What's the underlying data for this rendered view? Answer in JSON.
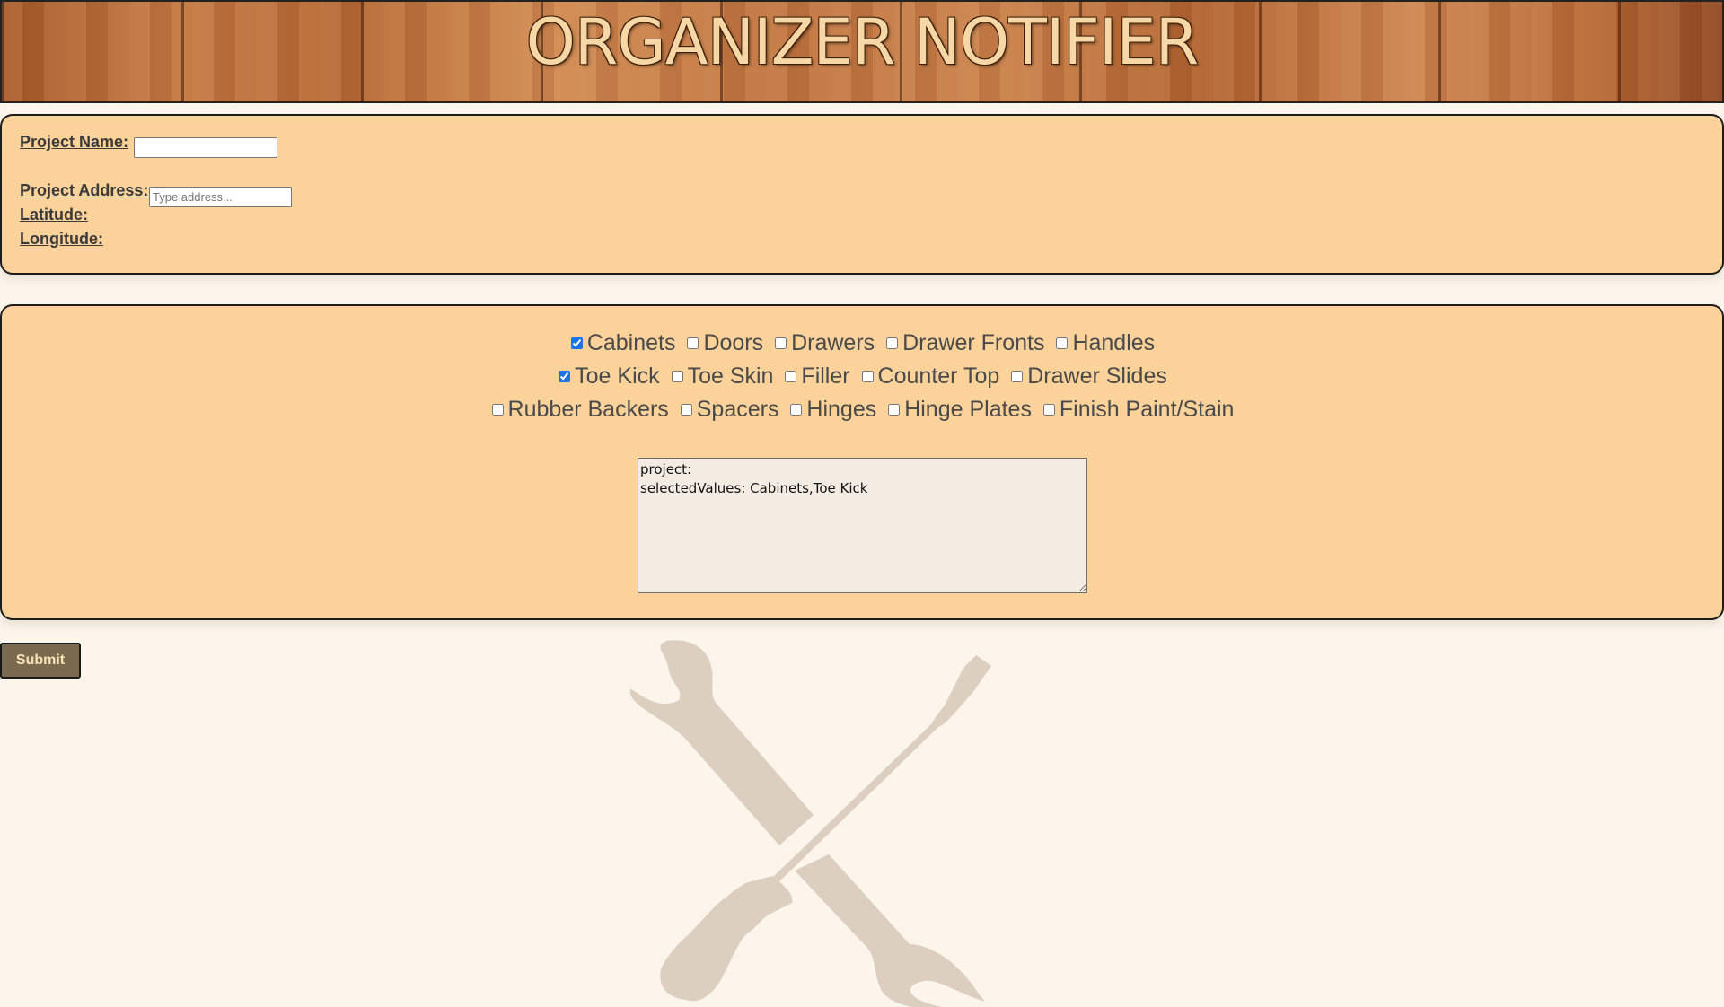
{
  "header": {
    "title": "ORGANIZER NOTIFIER"
  },
  "project": {
    "name_label": "Project Name:",
    "name_value": "",
    "address_label": "Project Address:",
    "address_placeholder": "Type address...",
    "address_value": "",
    "latitude_label": "Latitude:",
    "longitude_label": "Longitude:"
  },
  "items": {
    "rows": [
      [
        {
          "label": "Cabinets",
          "checked": true
        },
        {
          "label": "Doors",
          "checked": false
        },
        {
          "label": "Drawers",
          "checked": false
        },
        {
          "label": "Drawer Fronts",
          "checked": false
        },
        {
          "label": "Handles",
          "checked": false
        }
      ],
      [
        {
          "label": "Toe Kick",
          "checked": true
        },
        {
          "label": "Toe Skin",
          "checked": false
        },
        {
          "label": "Filler",
          "checked": false
        },
        {
          "label": "Counter Top",
          "checked": false
        },
        {
          "label": "Drawer Slides",
          "checked": false
        }
      ],
      [
        {
          "label": "Rubber Backers",
          "checked": false
        },
        {
          "label": "Spacers",
          "checked": false
        },
        {
          "label": "Hinges",
          "checked": false
        },
        {
          "label": "Hinge Plates",
          "checked": false
        },
        {
          "label": "Finish Paint/Stain",
          "checked": false
        }
      ]
    ],
    "output_text": "project:\nselectedValues: Cabinets,Toe Kick"
  },
  "submit_label": "Submit",
  "graphic": {
    "icon": "wrench-screwdriver-icon",
    "color": "#dccfbf"
  },
  "colors": {
    "panel_bg": "#fad29a",
    "page_bg": "#fcf5eb",
    "submit_bg": "#7a6a4f",
    "title_color": "#f7d7a6"
  }
}
